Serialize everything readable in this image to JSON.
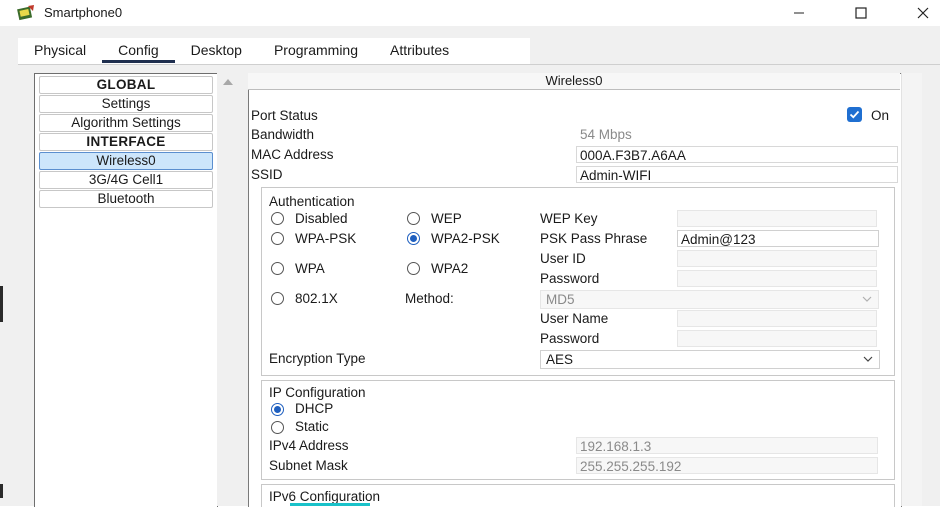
{
  "window": {
    "title": "Smartphone0",
    "icon": "packet-tracer-smartphone-icon",
    "controls": [
      "minimize-icon",
      "maximize-icon",
      "close-icon"
    ]
  },
  "tabs": [
    {
      "label": "Physical"
    },
    {
      "label": "Config"
    },
    {
      "label": "Desktop"
    },
    {
      "label": "Programming"
    },
    {
      "label": "Attributes"
    }
  ],
  "active_tab": "Config",
  "sidebar": {
    "items": [
      {
        "label": "GLOBAL"
      },
      {
        "label": "Settings"
      },
      {
        "label": "Algorithm Settings"
      },
      {
        "label": "INTERFACE"
      },
      {
        "label": "Wireless0"
      },
      {
        "label": "3G/4G Cell1"
      },
      {
        "label": "Bluetooth"
      }
    ],
    "selected": "Wireless0"
  },
  "panel": {
    "title": "Wireless0",
    "port_status": {
      "label": "Port Status",
      "checkbox_label": "On",
      "checked": true
    },
    "bandwidth": {
      "label": "Bandwidth",
      "value": "54 Mbps"
    },
    "mac": {
      "label": "MAC Address",
      "value": "000A.F3B7.A6AA"
    },
    "ssid": {
      "label": "SSID",
      "value": "Admin-WIFI"
    },
    "auth": {
      "title": "Authentication",
      "options": {
        "disabled": "Disabled",
        "wep": "WEP",
        "wpa_psk": "WPA-PSK",
        "wpa2_psk": "WPA2-PSK",
        "wpa": "WPA",
        "wpa2": "WPA2",
        "dot1x": "802.1X"
      },
      "selected": "WPA2-PSK",
      "wep_key": {
        "label": "WEP Key",
        "value": ""
      },
      "psk": {
        "label": "PSK Pass Phrase",
        "value": "Admin@123"
      },
      "user_id": {
        "label": "User ID",
        "value": ""
      },
      "password": {
        "label": "Password",
        "value": ""
      },
      "method": {
        "label": "Method:",
        "value": "MD5"
      },
      "user_name": {
        "label": "User Name",
        "value": ""
      },
      "password2": {
        "label": "Password",
        "value": ""
      },
      "encryption": {
        "label": "Encryption Type",
        "value": "AES"
      }
    },
    "ip": {
      "title": "IP Configuration",
      "dhcp": "DHCP",
      "static": "Static",
      "selected": "DHCP",
      "ipv4": {
        "label": "IPv4 Address",
        "value": "192.168.1.3"
      },
      "mask": {
        "label": "Subnet Mask",
        "value": "255.255.255.192"
      }
    },
    "ipv6": {
      "title": "IPv6 Configuration"
    }
  },
  "colors": {
    "accent": "#1f6fd1",
    "selection": "#cde6fb",
    "tab_underline": "#1f2f4f"
  }
}
